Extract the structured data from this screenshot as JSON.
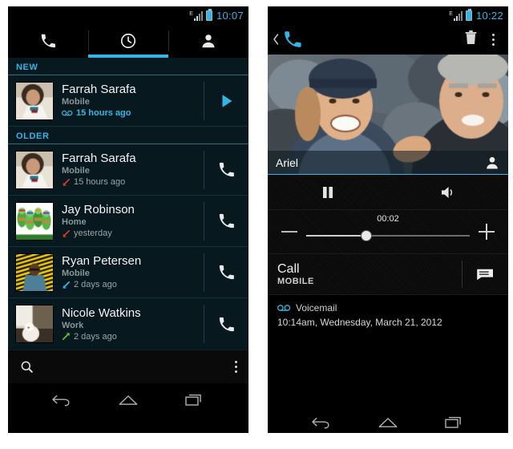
{
  "colors": {
    "accent": "#33b5e5",
    "list_bg": "#07181f",
    "missed": "#d9382b",
    "incoming": "#33b5e5",
    "outgoing": "#5fbf3a",
    "black": "#000000"
  },
  "left_phone": {
    "status_bar": {
      "network": "E",
      "time": "10:07"
    },
    "tabs": [
      {
        "icon": "phone-icon",
        "label": "Dialer",
        "active": false
      },
      {
        "icon": "clock-icon",
        "label": "Call log",
        "active": true
      },
      {
        "icon": "person-icon",
        "label": "Contacts",
        "active": false
      }
    ],
    "sections": [
      {
        "header": "NEW",
        "rows": [
          {
            "name": "Farrah Sarafa",
            "number_type": "Mobile",
            "when": "15 hours ago",
            "marker": "voicemail",
            "when_color": "#33b5e5",
            "action_icon": "play-icon",
            "avatar": "woman-headset"
          }
        ]
      },
      {
        "header": "OLDER",
        "rows": [
          {
            "name": "Farrah Sarafa",
            "number_type": "Mobile",
            "when": "15 hours ago",
            "marker": "missed",
            "when_color": "#9aa5a8",
            "action_icon": "phone-icon",
            "avatar": "woman-headset"
          },
          {
            "name": "Jay Robinson",
            "number_type": "Home",
            "when": "yesterday",
            "marker": "missed",
            "when_color": "#9aa5a8",
            "action_icon": "phone-icon",
            "avatar": "turtles"
          },
          {
            "name": "Ryan Petersen",
            "number_type": "Mobile",
            "when": "2 days ago",
            "marker": "incoming",
            "when_color": "#9aa5a8",
            "action_icon": "phone-icon",
            "avatar": "yellow-stripes"
          },
          {
            "name": "Nicole Watkins",
            "number_type": "Work",
            "when": "2 days ago",
            "marker": "outgoing",
            "when_color": "#9aa5a8",
            "action_icon": "phone-icon",
            "avatar": "dog"
          }
        ]
      }
    ],
    "bottom_bar": {
      "search_icon": "search-icon",
      "overflow_icon": "overflow-menu-icon"
    },
    "nav_bar": {
      "back": "back-icon",
      "home": "home-icon",
      "recents": "recents-icon"
    }
  },
  "right_phone": {
    "status_bar": {
      "network": "E",
      "time": "10:22"
    },
    "action_bar": {
      "up_icon": "back-chevron-icon",
      "app_icon": "phone-icon",
      "delete_icon": "trash-icon",
      "overflow_icon": "overflow-menu-icon"
    },
    "photo": {
      "contact_name": "Ariel",
      "badge_icon": "person-icon"
    },
    "player": {
      "pause_icon": "pause-icon",
      "speaker_icon": "speaker-icon",
      "elapsed": "00:02",
      "progress_percent": 37,
      "decrease_icon": "minus-icon",
      "increase_icon": "plus-icon"
    },
    "call_row": {
      "title": "Call",
      "subtitle": "MOBILE",
      "action_icon": "message-icon"
    },
    "meta": {
      "kind_icon": "voicemail-icon",
      "kind": "Voicemail",
      "date": "10:14am, Wednesday, March 21, 2012"
    },
    "nav_bar": {
      "back": "back-icon",
      "home": "home-icon",
      "recents": "recents-icon"
    }
  }
}
